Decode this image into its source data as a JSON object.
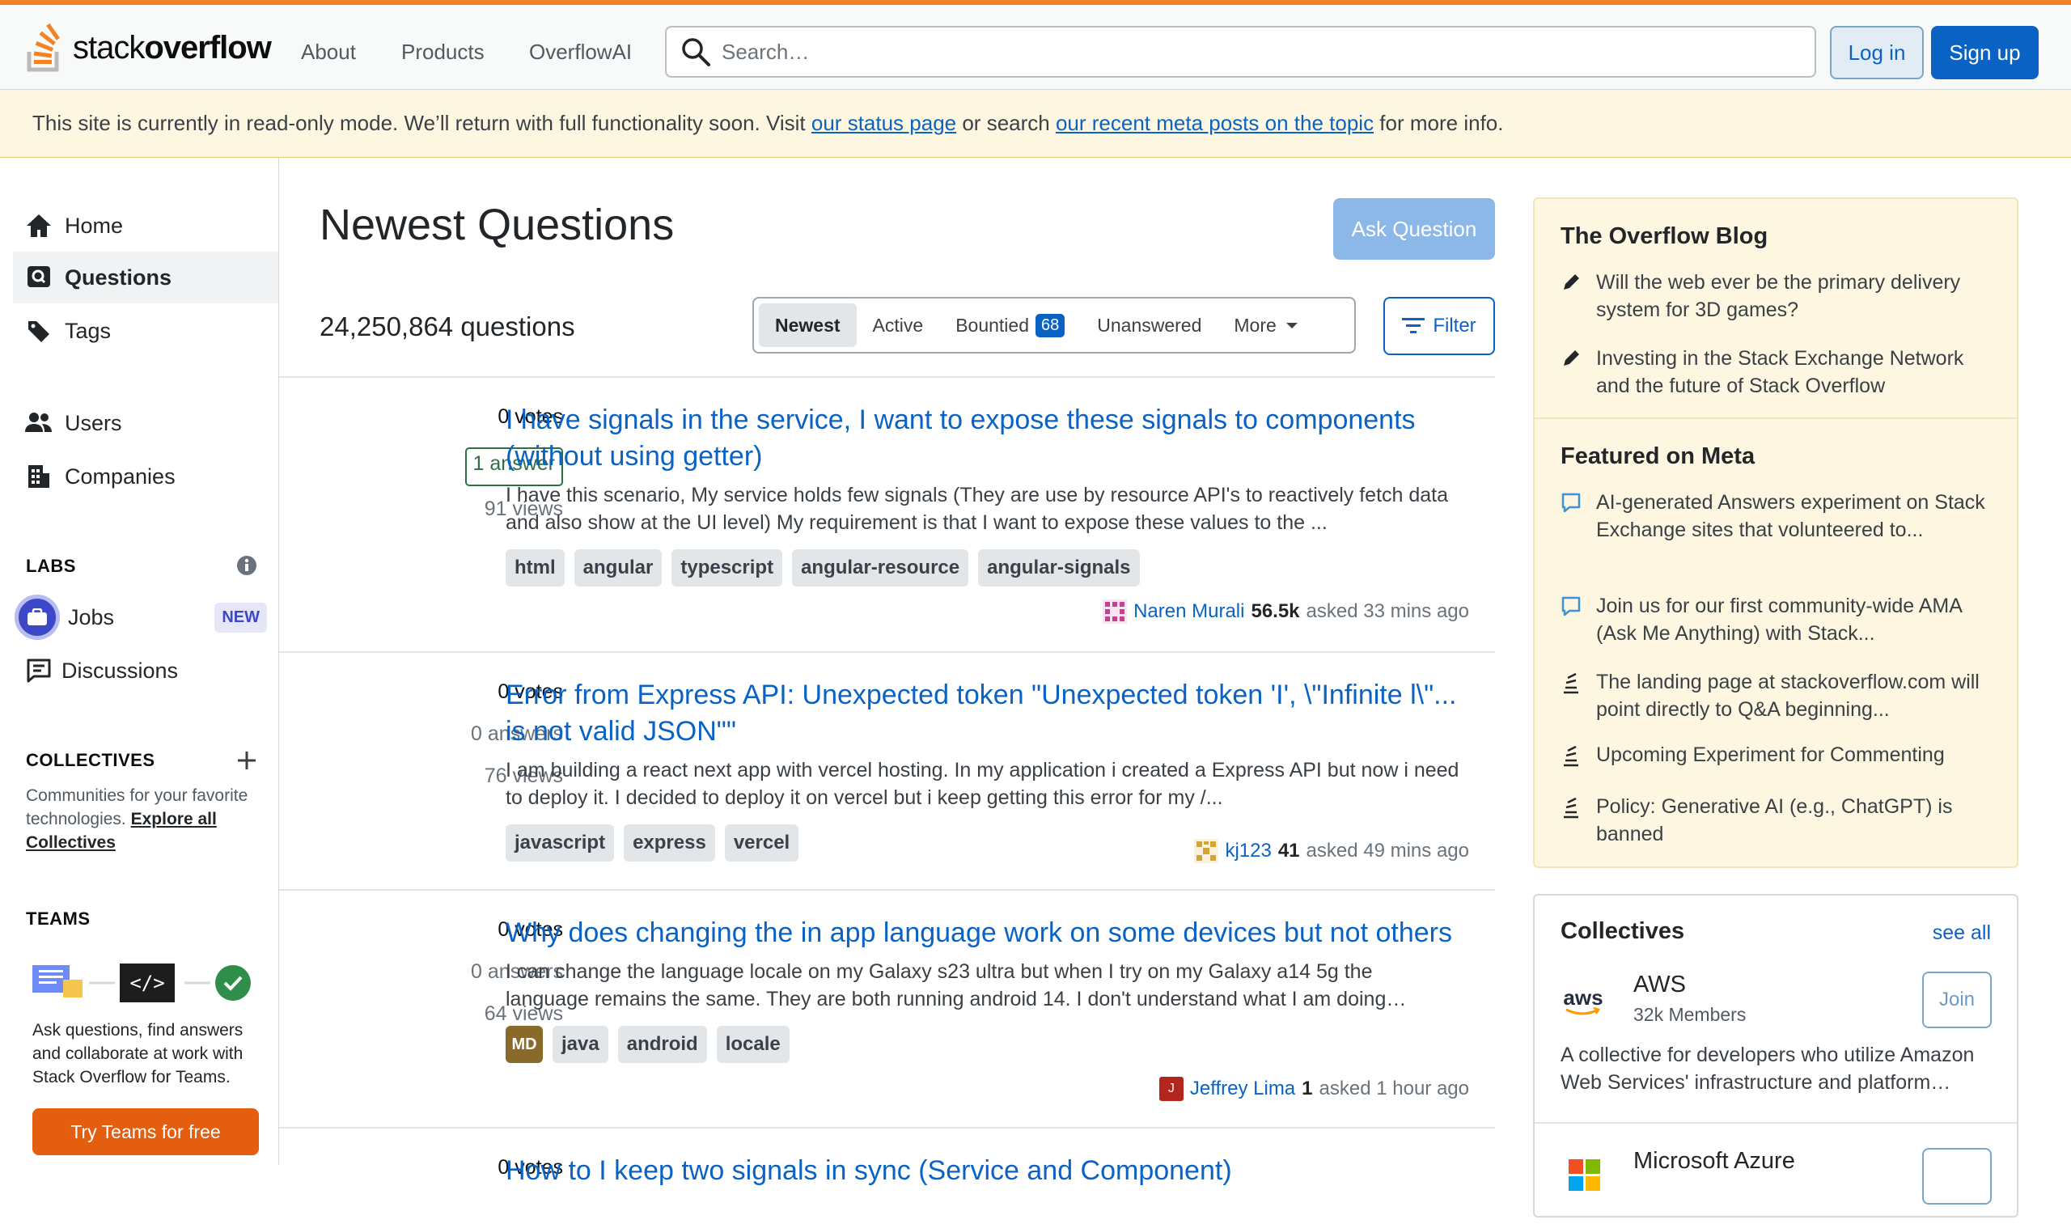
{
  "header": {
    "logo_text_light": "stack",
    "logo_text_bold": "overflow",
    "nav": [
      "About",
      "Products",
      "OverflowAI"
    ],
    "search_placeholder": "Search…",
    "login": "Log in",
    "signup": "Sign up"
  },
  "notice": {
    "pre": "This site is currently in read-only mode. We’ll return with full functionality soon. Visit ",
    "link1": "our status page",
    "mid": " or search ",
    "link2": "our recent meta posts on the topic",
    "post": " for more info."
  },
  "leftnav": {
    "home": "Home",
    "questions": "Questions",
    "tags": "Tags",
    "users": "Users",
    "companies": "Companies",
    "labs_label": "LABS",
    "jobs": "Jobs",
    "jobs_badge": "NEW",
    "discussions": "Discussions",
    "collectives_label": "COLLECTIVES",
    "collectives_desc": "Communities for your favorite technologies. ",
    "collectives_link": "Explore all Collectives",
    "teams_label": "TEAMS",
    "teams_desc": "Ask questions, find answers and collaborate at work with Stack Overflow for Teams.",
    "teams_btn": "Try Teams for free"
  },
  "main": {
    "title": "Newest Questions",
    "ask": "Ask Question",
    "count": "24,250,864 questions",
    "tabs": {
      "newest": "Newest",
      "active": "Active",
      "bountied": "Bountied",
      "bountied_count": "68",
      "unanswered": "Unanswered",
      "more": "More"
    },
    "filter": "Filter"
  },
  "questions": [
    {
      "votes": "0 votes",
      "answers": "1 answer",
      "views": "91 views",
      "title": "I have signals in the service, I want to expose these signals to components (without using getter)",
      "excerpt": "I have this scenario, My service holds few signals (They are use by resource API's to reactively fetch data and also show at the UI level) My requirement is that I want to expose these values to the ...",
      "tags": [
        "html",
        "angular",
        "typescript",
        "angular-resource",
        "angular-signals"
      ],
      "user": "Naren Murali",
      "rep": "56.5k",
      "asked": "asked 33 mins ago"
    },
    {
      "votes": "0 votes",
      "answers": "0 answers",
      "views": "76 views",
      "title": "Error from Express API: Unexpected token \"Unexpected token 'I', \\\"Infinite l\\\"... is not valid JSON\"\"",
      "excerpt": "I am building a react next app with vercel hosting. In my application i created a Express API but now i need to deploy it. I decided to deploy it on vercel but i keep getting this error for my /...",
      "tags": [
        "javascript",
        "express",
        "vercel"
      ],
      "user": "kj123",
      "rep": "41",
      "asked": "asked 49 mins ago"
    },
    {
      "votes": "0 votes",
      "answers": "0 answers",
      "views": "64 views",
      "title": "Why does changing the in app language work on some devices but not others",
      "excerpt": "I can change the language locale on my Galaxy s23 ultra but when I try on my Galaxy a14 5g the language remains the same. They are both running android 14. I don't understand what I am doing…",
      "tags": [
        "java",
        "android",
        "locale"
      ],
      "tag_badge": "MD",
      "user": "Jeffrey Lima",
      "user_initial": "J",
      "rep": "1",
      "asked": "asked 1 hour ago"
    },
    {
      "votes": "0 votes",
      "title": "How to I keep two signals in sync (Service and Component)"
    }
  ],
  "blog": {
    "heading": "The Overflow Blog",
    "items": [
      "Will the web ever be the primary delivery system for 3D games?",
      "Investing in the Stack Exchange Network and the future of Stack Overflow"
    ],
    "meta_heading": "Featured on Meta",
    "meta_items": [
      "AI-generated Answers experiment on Stack Exchange sites that volunteered to...",
      "Join us for our first community-wide AMA (Ask Me Anything) with Stack...",
      "The landing page at stackoverflow.com will point directly to Q&A beginning...",
      "Upcoming Experiment for Commenting",
      "Policy: Generative AI (e.g., ChatGPT) is banned"
    ]
  },
  "collectives": {
    "heading": "Collectives",
    "see_all": "see all",
    "aws_logo": "aws",
    "aws_name": "AWS",
    "aws_members": "32k Members",
    "join": "Join",
    "aws_desc": "A collective for developers who utilize Amazon Web Services' infrastructure and platform…",
    "azure_name": "Microsoft Azure"
  },
  "colors": {
    "accent": "#f48225",
    "link": "#0a63c4",
    "blog_bg": "#fdf7e2",
    "teams_btn": "#e35e0e"
  }
}
